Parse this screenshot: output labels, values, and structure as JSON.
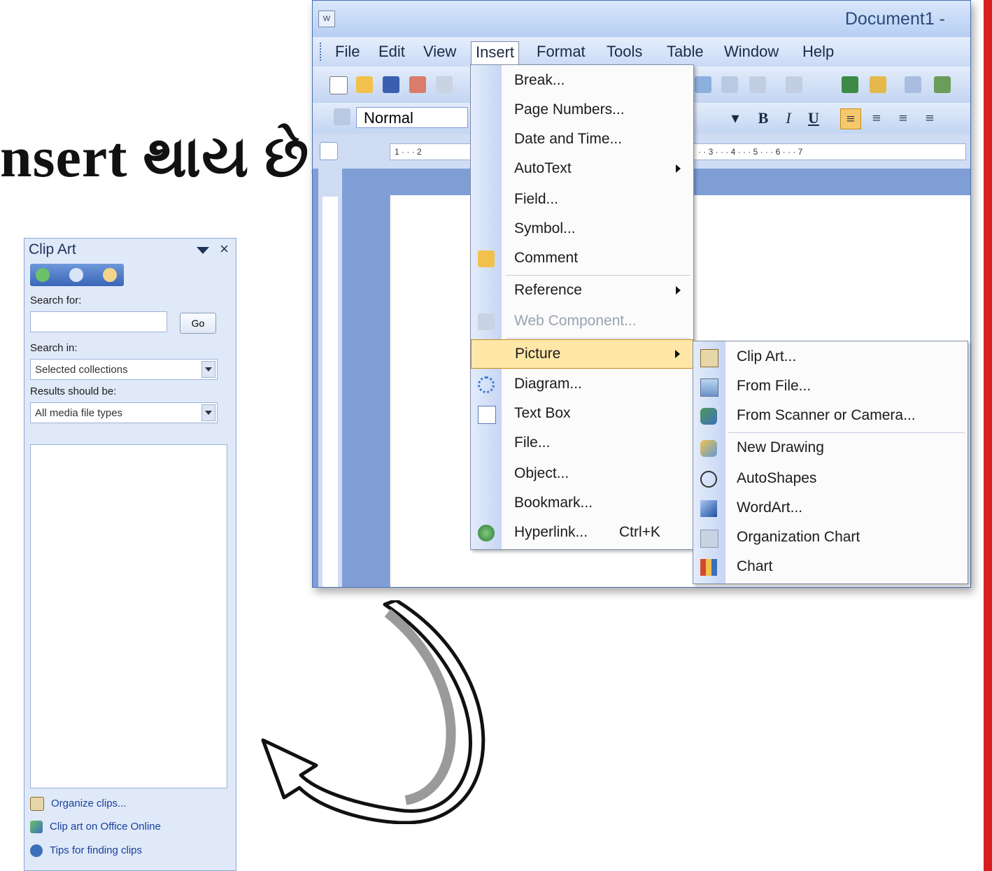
{
  "heading": {
    "text": "nsert થાય  છે."
  },
  "word": {
    "title": "Document1 -",
    "app_icon": "W",
    "menubar": [
      "File",
      "Edit",
      "View",
      "Insert",
      "Format",
      "Tools",
      "Table",
      "Window",
      "Help"
    ],
    "style_value": "Normal",
    "format_buttons": [
      "B",
      "I",
      "U"
    ],
    "ruler_marks": "1 · · · 2",
    "ruler_marks_right": "· · 3 · · · 4 · · · 5 · · · 6 · · · 7"
  },
  "insert_menu": {
    "items": [
      {
        "label": "Break..."
      },
      {
        "label": "Page Numbers..."
      },
      {
        "label": "Date and Time..."
      },
      {
        "label": "AutoText"
      },
      {
        "label": "Field..."
      },
      {
        "label": "Symbol..."
      },
      {
        "label": "Comment"
      },
      {
        "label": "Reference"
      },
      {
        "label": "Web Component..."
      },
      {
        "label": "Picture"
      },
      {
        "label": "Diagram..."
      },
      {
        "label": "Text Box"
      },
      {
        "label": "File..."
      },
      {
        "label": "Object..."
      },
      {
        "label": "Bookmark..."
      },
      {
        "label": "Hyperlink...",
        "shortcut": "Ctrl+K"
      }
    ]
  },
  "picture_menu": {
    "items": [
      {
        "label": "Clip Art..."
      },
      {
        "label": "From File..."
      },
      {
        "label": "From Scanner or Camera..."
      },
      {
        "label": "New Drawing"
      },
      {
        "label": "AutoShapes"
      },
      {
        "label": "WordArt..."
      },
      {
        "label": "Organization Chart"
      },
      {
        "label": "Chart"
      }
    ]
  },
  "clip_art": {
    "title": "Clip Art",
    "search_for_label": "Search for:",
    "search_value": "",
    "go_label": "Go",
    "search_in_label": "Search in:",
    "search_in_value": "Selected collections",
    "results_label": "Results should be:",
    "results_value": "All media file types",
    "links": [
      "Organize clips...",
      "Clip art on Office Online",
      "Tips for finding clips"
    ]
  }
}
